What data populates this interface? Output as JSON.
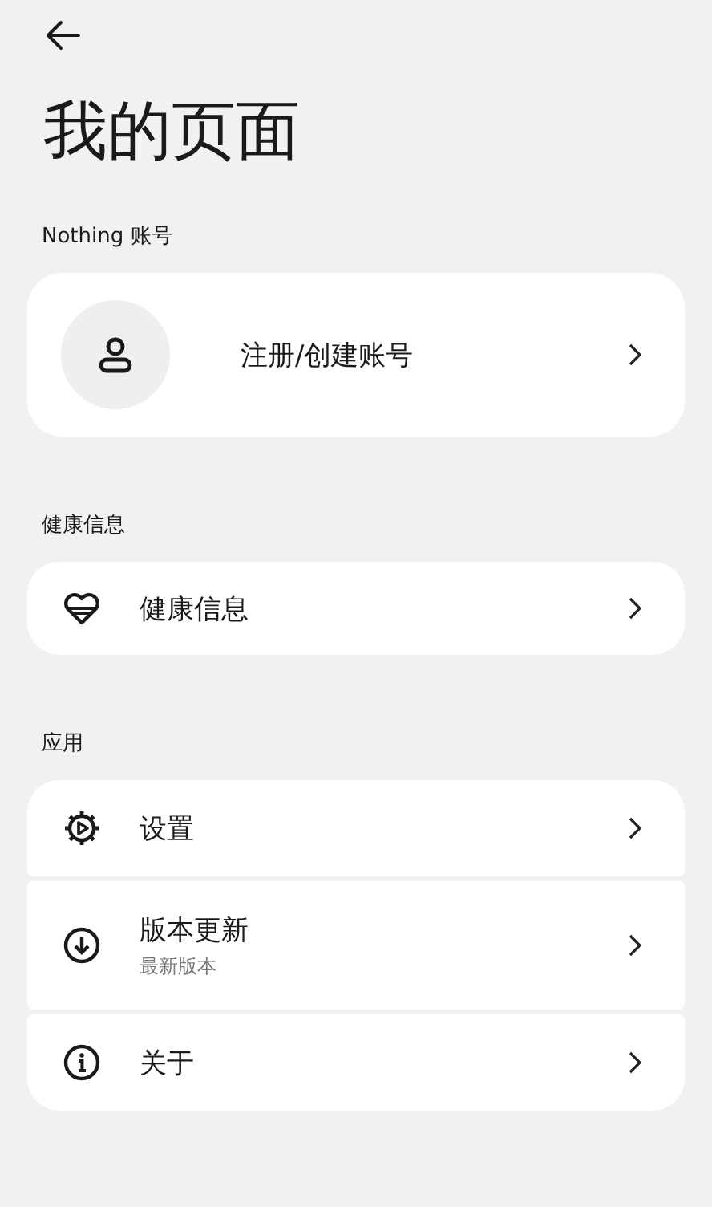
{
  "header": {
    "title": "我的页面"
  },
  "account": {
    "section_label": "Nothing 账号",
    "item": {
      "label": "注册/创建账号"
    }
  },
  "health": {
    "section_label": "健康信息",
    "item": {
      "label": "健康信息"
    }
  },
  "apps": {
    "section_label": "应用",
    "items": [
      {
        "label": "设置"
      },
      {
        "label": "版本更新",
        "subtitle": "最新版本"
      },
      {
        "label": "关于"
      }
    ]
  }
}
